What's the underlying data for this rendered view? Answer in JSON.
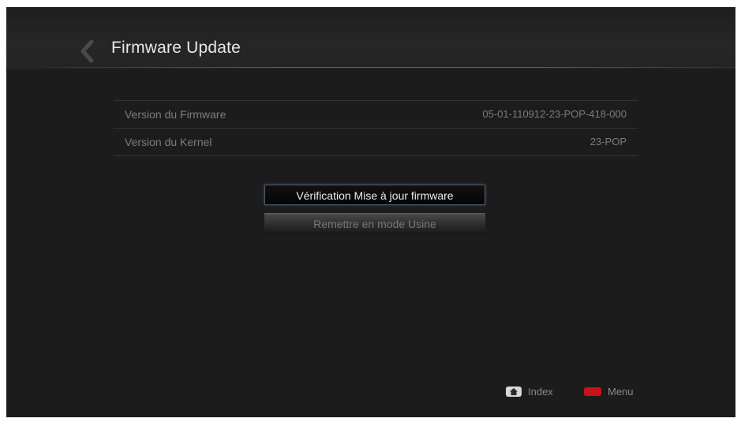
{
  "header": {
    "title": "Firmware Update",
    "back_icon": "chevron-left-icon"
  },
  "info": {
    "rows": [
      {
        "label": "Version du Firmware",
        "value": "05-01-110912-23-POP-418-000"
      },
      {
        "label": "Version du Kernel",
        "value": "23-POP"
      }
    ]
  },
  "actions": {
    "check_update_label": "Vérification Mise à jour firmware",
    "factory_reset_label": "Remettre en mode Usine"
  },
  "footer": {
    "index_label": "Index",
    "index_icon": "home-icon",
    "menu_label": "Menu",
    "menu_icon": "red-button-icon"
  },
  "colors": {
    "background": "#1c1c1c",
    "focus_border": "#4a5a66",
    "menu_key": "#c8121a"
  }
}
